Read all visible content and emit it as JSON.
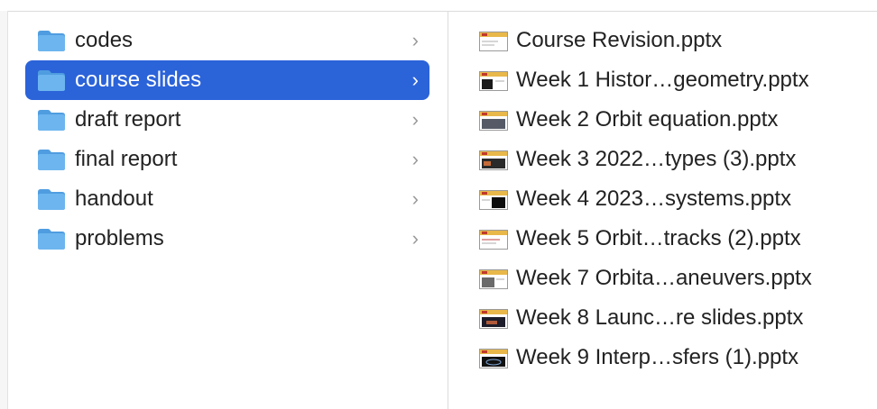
{
  "colors": {
    "selection": "#2b63d9",
    "folder_blue": "#5aa8e8",
    "text": "#222222",
    "chevron": "#9a9a9a"
  },
  "folders": [
    {
      "label": "codes",
      "icon": "folder-icon",
      "selected": false
    },
    {
      "label": "course slides",
      "icon": "folder-icon",
      "selected": true
    },
    {
      "label": "draft report",
      "icon": "folder-icon",
      "selected": false
    },
    {
      "label": "final report",
      "icon": "folder-icon",
      "selected": false
    },
    {
      "label": "handout",
      "icon": "folder-icon",
      "selected": false
    },
    {
      "label": "problems",
      "icon": "folder-icon",
      "selected": false
    }
  ],
  "chevron_glyph": "›",
  "files": [
    {
      "label": "Course Revision.pptx",
      "icon": "pptx-thumbnail-icon"
    },
    {
      "label": "Week 1 Histor…geometry.pptx",
      "icon": "pptx-thumbnail-icon"
    },
    {
      "label": "Week 2 Orbit equation.pptx",
      "icon": "pptx-thumbnail-icon"
    },
    {
      "label": "Week 3 2022…types (3).pptx",
      "icon": "pptx-thumbnail-icon"
    },
    {
      "label": "Week 4 2023…systems.pptx",
      "icon": "pptx-thumbnail-icon"
    },
    {
      "label": "Week 5 Orbit…tracks (2).pptx",
      "icon": "pptx-thumbnail-icon"
    },
    {
      "label": "Week 7 Orbita…aneuvers.pptx",
      "icon": "pptx-thumbnail-icon"
    },
    {
      "label": "Week 8 Launc…re slides.pptx",
      "icon": "pptx-thumbnail-icon"
    },
    {
      "label": "Week 9 Interp…sfers (1).pptx",
      "icon": "pptx-thumbnail-icon"
    }
  ]
}
